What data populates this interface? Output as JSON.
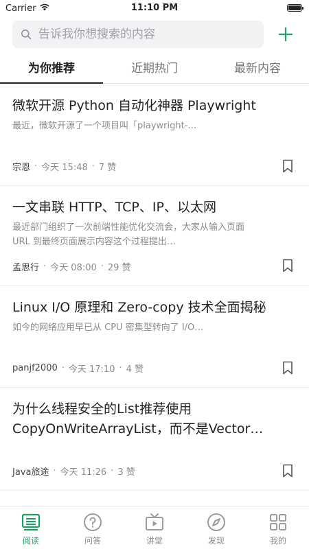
{
  "status_bar": {
    "carrier": "Carrier",
    "time": "11:10 PM"
  },
  "search": {
    "placeholder": "告诉我你想搜索的内容"
  },
  "tabs": [
    {
      "label": "为你推荐",
      "active": true
    },
    {
      "label": "近期热门",
      "active": false
    },
    {
      "label": "最新内容",
      "active": false
    }
  ],
  "articles": [
    {
      "title": "微软开源 Python 自动化神器 Playwright",
      "summary": "最近，微软开源了一个项目叫「playwright-…",
      "author": "宗恩",
      "time": "今天 15:48",
      "likes": "7 赞"
    },
    {
      "title": "一文串联 HTTP、TCP、IP、以太网",
      "summary": "最近部门组织了一次前端性能优化交流会，大家从输入页面 URL 到最终页面展示内容这个过程提出…",
      "author": "孟思行",
      "time": "今天 08:00",
      "likes": "29 赞"
    },
    {
      "title": "Linux I/O 原理和 Zero-copy 技术全面揭秘",
      "summary": "如今的网络应用早已从 CPU 密集型转向了 I/O…",
      "author": "panjf2000",
      "time": "今天 17:10",
      "likes": "4 赞"
    },
    {
      "title": "为什么线程安全的List推荐使用CopyOnWriteArrayList，而不是Vector…",
      "summary": "",
      "author": "Java旅途",
      "time": "今天 11:26",
      "likes": "3 赞"
    }
  ],
  "tab_bar": [
    {
      "label": "阅读",
      "icon": "reading-icon",
      "active": true
    },
    {
      "label": "问答",
      "icon": "question-icon",
      "active": false
    },
    {
      "label": "讲堂",
      "icon": "tv-icon",
      "active": false
    },
    {
      "label": "发现",
      "icon": "compass-icon",
      "active": false
    },
    {
      "label": "我的",
      "icon": "grid-icon",
      "active": false
    }
  ],
  "colors": {
    "accent": "#1f9e64",
    "text": "#202225",
    "muted": "#8a8c90"
  }
}
